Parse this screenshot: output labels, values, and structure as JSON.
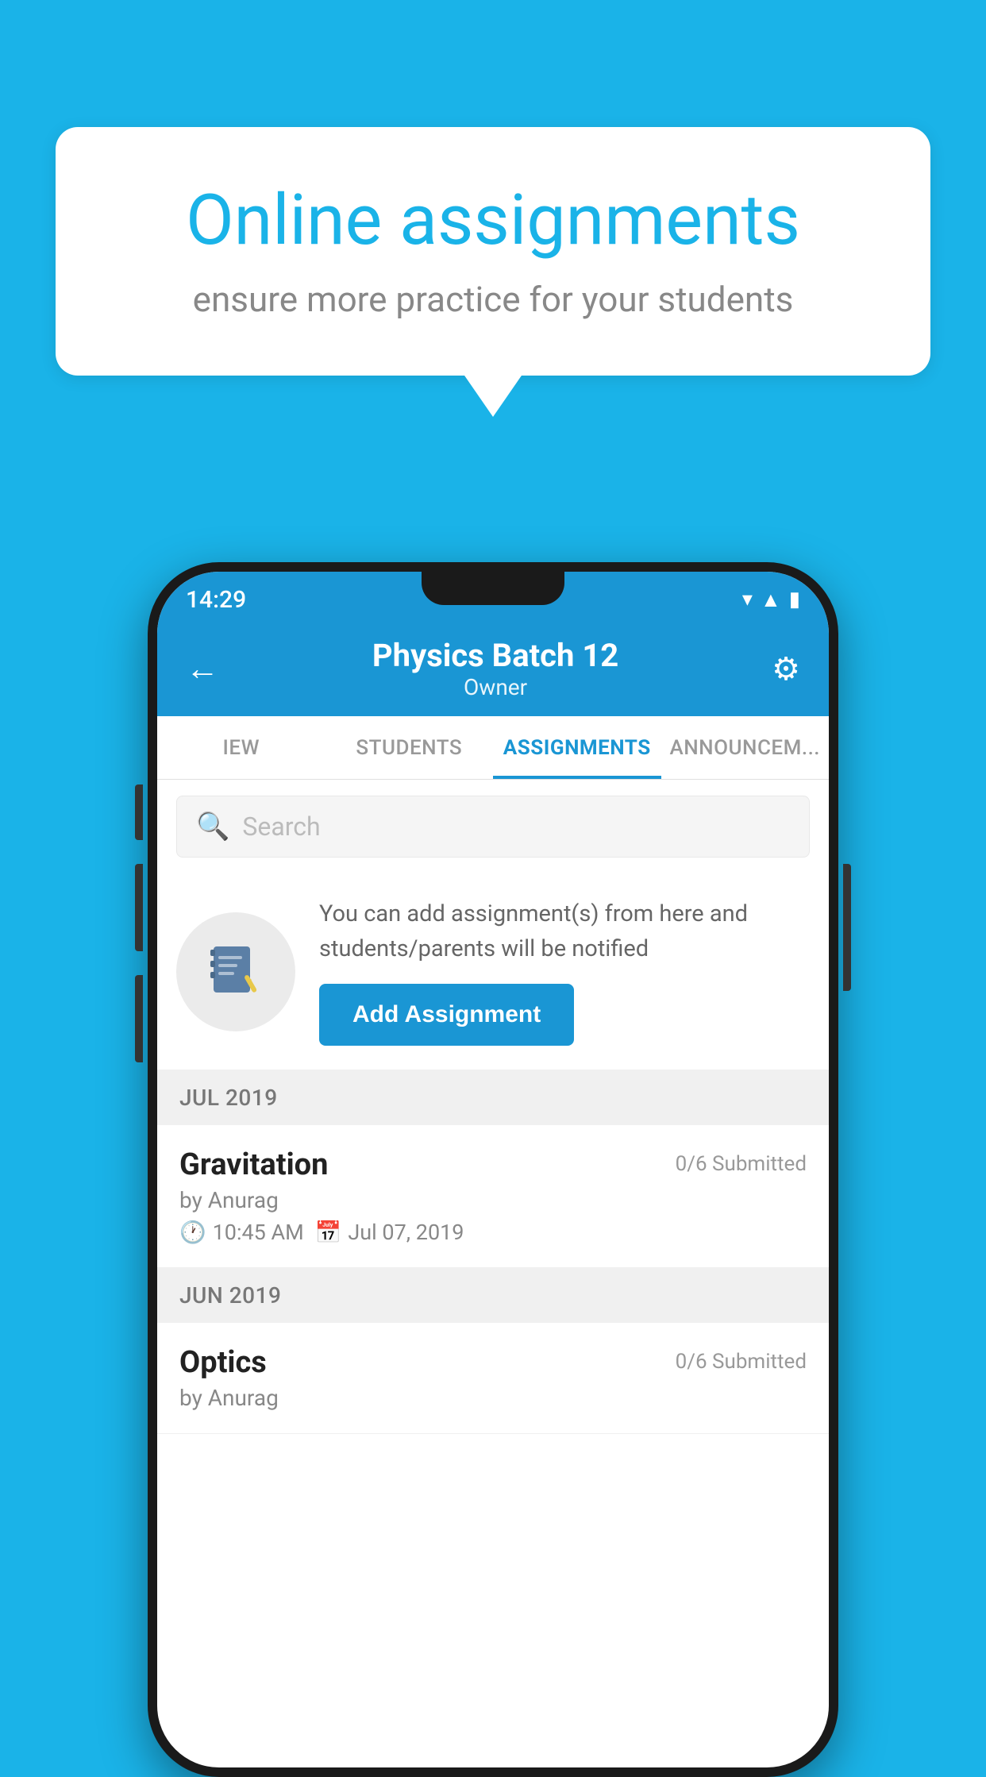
{
  "background_color": "#1ab3e8",
  "speech_bubble": {
    "title": "Online assignments",
    "subtitle": "ensure more practice for your students"
  },
  "status_bar": {
    "time": "14:29",
    "icons": [
      "wifi",
      "signal",
      "battery"
    ]
  },
  "header": {
    "title": "Physics Batch 12",
    "subtitle": "Owner",
    "back_label": "←",
    "settings_label": "⚙"
  },
  "tabs": [
    {
      "label": "IEW",
      "active": false
    },
    {
      "label": "STUDENTS",
      "active": false
    },
    {
      "label": "ASSIGNMENTS",
      "active": true
    },
    {
      "label": "ANNOUNCEM...",
      "active": false
    }
  ],
  "search": {
    "placeholder": "Search"
  },
  "info_card": {
    "description": "You can add assignment(s) from here and students/parents will be notified",
    "button_label": "Add Assignment"
  },
  "sections": [
    {
      "month": "JUL 2019",
      "assignments": [
        {
          "name": "Gravitation",
          "submitted": "0/6 Submitted",
          "author": "by Anurag",
          "time": "10:45 AM",
          "date": "Jul 07, 2019"
        }
      ]
    },
    {
      "month": "JUN 2019",
      "assignments": [
        {
          "name": "Optics",
          "submitted": "0/6 Submitted",
          "author": "by Anurag",
          "time": "",
          "date": ""
        }
      ]
    }
  ]
}
